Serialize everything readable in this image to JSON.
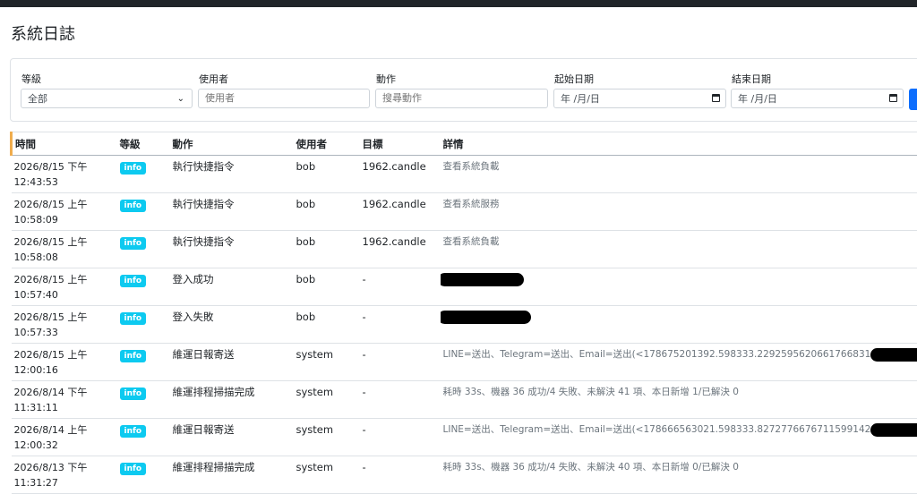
{
  "page": {
    "title": "系統日誌"
  },
  "filters": {
    "level_label": "等級",
    "level_value": "全部",
    "user_label": "使用者",
    "user_placeholder": "使用者",
    "action_label": "動作",
    "action_placeholder": "搜尋動作",
    "start_label": "起始日期",
    "start_value": "年 /月/日",
    "end_label": "結束日期",
    "end_value": "年 /月/日"
  },
  "table": {
    "headers": [
      "時間",
      "等級",
      "動作",
      "使用者",
      "目標",
      "詳情"
    ],
    "rows": [
      {
        "time1": "2026/8/15 下午",
        "time2": "12:43:53",
        "level": "info",
        "action": "執行快捷指令",
        "user": "bob",
        "target": "1962.candle",
        "detail": "查看系統負載",
        "redacted": false
      },
      {
        "time1": "2026/8/15 上午",
        "time2": "10:58:09",
        "level": "info",
        "action": "執行快捷指令",
        "user": "bob",
        "target": "1962.candle",
        "detail": "查看系統服務",
        "redacted": false
      },
      {
        "time1": "2026/8/15 上午",
        "time2": "10:58:08",
        "level": "info",
        "action": "執行快捷指令",
        "user": "bob",
        "target": "1962.candle",
        "detail": "查看系統負載",
        "redacted": false
      },
      {
        "time1": "2026/8/15 上午",
        "time2": "10:57:40",
        "level": "info",
        "action": "登入成功",
        "user": "bob",
        "target": "-",
        "detail": "",
        "redacted": true
      },
      {
        "time1": "2026/8/15 上午",
        "time2": "10:57:33",
        "level": "info",
        "action": "登入失敗",
        "user": "bob",
        "target": "-",
        "detail": "",
        "redacted": true
      },
      {
        "time1": "2026/8/15 上午",
        "time2": "12:00:16",
        "level": "info",
        "action": "維運日報寄送",
        "user": "system",
        "target": "-",
        "detail": "LINE=送出、Telegram=送出、Email=送出(<178675201392.598333.2292595620661766831",
        "redacted": true
      },
      {
        "time1": "2026/8/14 下午",
        "time2": "11:31:11",
        "level": "info",
        "action": "維運排程掃描完成",
        "user": "system",
        "target": "-",
        "detail": "耗時 33s、機器 36 成功/4 失敗、未解決 41 項、本日新增 1/已解決 0",
        "redacted": false
      },
      {
        "time1": "2026/8/14 上午",
        "time2": "12:00:32",
        "level": "info",
        "action": "維運日報寄送",
        "user": "system",
        "target": "-",
        "detail": "LINE=送出、Telegram=送出、Email=送出(<178666563021.598333.8272776676711599142",
        "redacted": true
      },
      {
        "time1": "2026/8/13 下午",
        "time2": "11:31:27",
        "level": "info",
        "action": "維運排程掃描完成",
        "user": "system",
        "target": "-",
        "detail": "耗時 33s、機器 36 成功/4 失敗、未解決 40 項、本日新增 0/已解決 0",
        "redacted": false
      }
    ]
  }
}
